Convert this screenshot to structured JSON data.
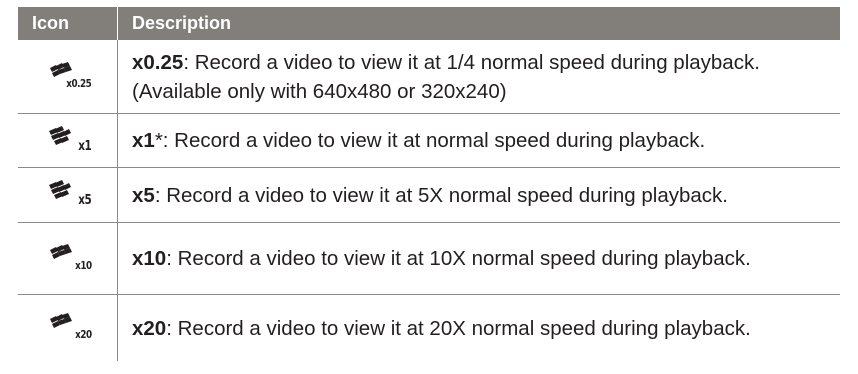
{
  "header": {
    "icon_col": "Icon",
    "desc_col": "Description"
  },
  "rows": [
    {
      "icon": "speed-x0.25-icon",
      "icon_label": "x0.25",
      "key": "x0.25",
      "text": ": Record a video to view it at 1/4 normal speed during playback. (Available only with 640x480 or 320x240)"
    },
    {
      "icon": "speed-x1-icon",
      "icon_label": "x1",
      "key": "x1",
      "text": "*: Record a video to view it at normal speed during playback."
    },
    {
      "icon": "speed-x5-icon",
      "icon_label": "x5",
      "key": "x5",
      "text": ": Record a video to view it at 5X normal speed during playback."
    },
    {
      "icon": "speed-x10-icon",
      "icon_label": "x10",
      "key": "x10",
      "text": ": Record a video to view it at 10X normal speed during playback."
    },
    {
      "icon": "speed-x20-icon",
      "icon_label": "x20",
      "key": "x20",
      "text": ": Record a video to view it at 20X normal speed during playback."
    }
  ]
}
